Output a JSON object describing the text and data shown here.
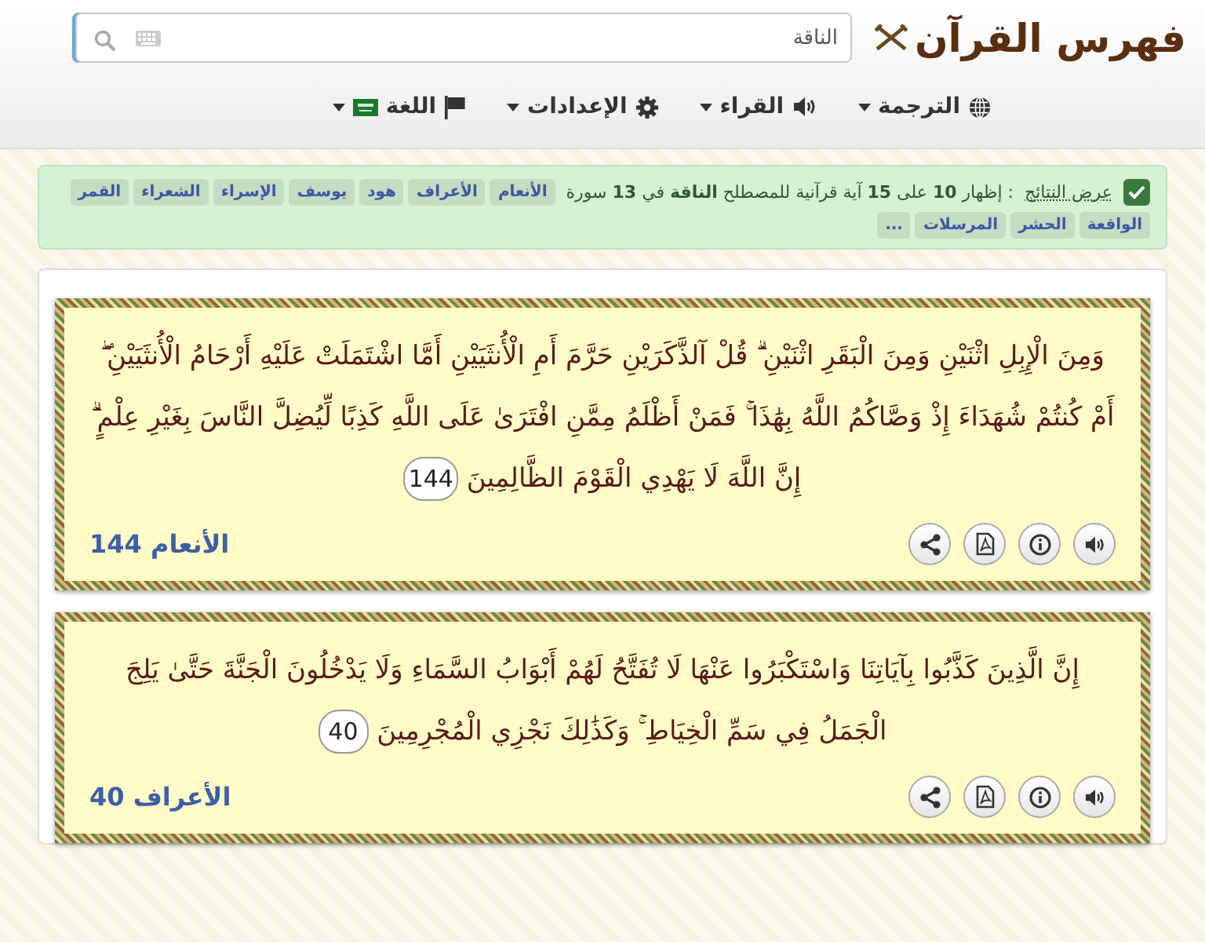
{
  "header": {
    "logo": "فهرس القرآن",
    "search": {
      "value": "الناقة"
    }
  },
  "nav": [
    {
      "label": "الترجمة"
    },
    {
      "label": "القراء"
    },
    {
      "label": "الإعدادات"
    },
    {
      "label": "اللغة"
    }
  ],
  "results": {
    "checked": true,
    "label": "عرض النتائج",
    "summary": ": إظهار **10** على **15** آية قرآنية للمصطلح **الناقة** في **13** سورة",
    "tags": [
      "الأنعام",
      "الأعراف",
      "هود",
      "يوسف",
      "الإسراء",
      "الشعراء",
      "القمر",
      "الواقعة",
      "الحشر",
      "المرسلات",
      "..."
    ]
  },
  "verses": [
    {
      "text": "وَمِنَ الْإِبِلِ اثْنَيْنِ وَمِنَ الْبَقَرِ اثْنَيْنِ ۗ قُلْ آلذَّكَرَيْنِ حَرَّمَ أَمِ الْأُنثَيَيْنِ أَمَّا اشْتَمَلَتْ عَلَيْهِ أَرْحَامُ الْأُنثَيَيْنِ ۖ أَمْ كُنتُمْ شُهَدَاءَ إِذْ وَصَّاكُمُ اللَّهُ بِهَٰذَا ۚ فَمَنْ أَظْلَمُ مِمَّنِ افْتَرَىٰ عَلَى اللَّهِ كَذِبًا لِّيُضِلَّ النَّاسَ بِغَيْرِ عِلْمٍ ۗ إِنَّ اللَّهَ لَا يَهْدِي الْقَوْمَ الظَّالِمِينَ",
      "number": "144",
      "reference": "الأنعام 144"
    },
    {
      "text": "إِنَّ الَّذِينَ كَذَّبُوا بِآيَاتِنَا وَاسْتَكْبَرُوا عَنْهَا لَا تُفَتَّحُ لَهُمْ أَبْوَابُ السَّمَاءِ وَلَا يَدْخُلُونَ الْجَنَّةَ حَتَّىٰ يَلِجَ الْجَمَلُ فِي سَمِّ الْخِيَاطِ ۚ وَكَذَٰلِكَ نَجْزِي الْمُجْرِمِينَ",
      "number": "40",
      "reference": "الأعراف 40"
    }
  ]
}
